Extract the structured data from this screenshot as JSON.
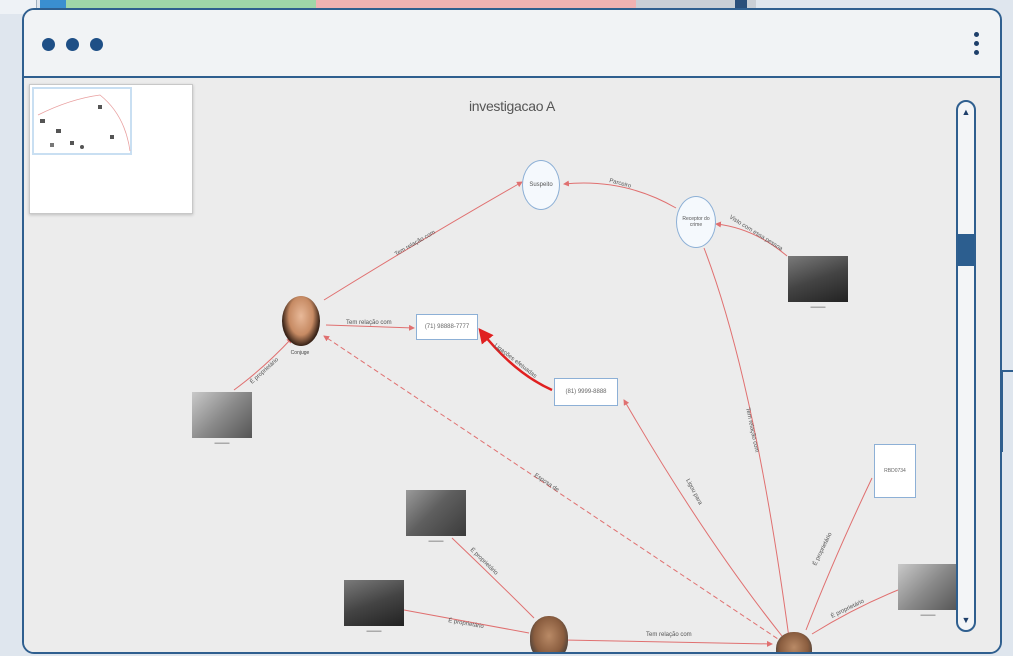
{
  "window": {
    "graph_title": "investigacao A"
  },
  "nodes": {
    "suspeito": "Suspeito",
    "receiver": "Receptor do crime",
    "conjuge": "Conjuge",
    "phone1": "(71) 98888-7777",
    "phone2": "(81) 9999-8888",
    "plate": "RBD0734"
  },
  "edges": {
    "e1": "Tem relação com",
    "e2": "Parceiro",
    "e3": "Visto com essa pessoa",
    "e4": "Tem relação com",
    "e5": "Ligações efetuadas",
    "e6": "É proprietário",
    "e7": "Esposa de",
    "e8": "Tem relação com",
    "e9": "Ligou para",
    "e10": "É proprietário",
    "e11": "É proprietário",
    "e12": "Tem relação com",
    "e13": "É proprietário",
    "e14": "É proprietário"
  },
  "colors": {
    "frame": "#2f5f8f",
    "edge": "#e07070",
    "edge_strong": "#e02020"
  }
}
